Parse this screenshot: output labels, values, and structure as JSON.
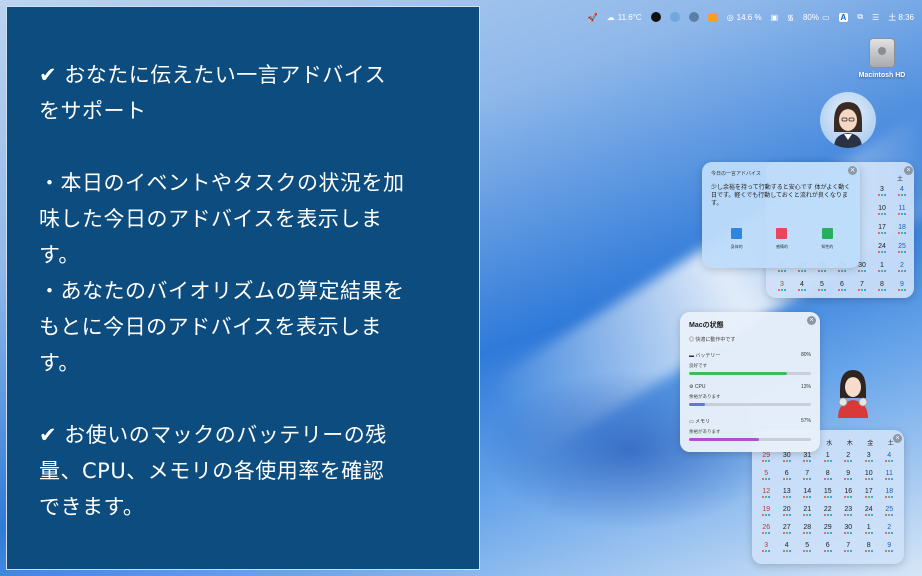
{
  "menubar": {
    "temperature": "11.6°C",
    "cpu_percent": "14.6 %",
    "battery_percent": "80%",
    "input_mode": "A",
    "time": "土 8:36"
  },
  "panel": {
    "line1": "✔ おなたに伝えたい一言アドバイス",
    "line2": "をサポート",
    "line3": "・本日のイベントやタスクの状況を加",
    "line4": "味した今日のアドバイスを表示しま",
    "line5": "す。",
    "line6": "・あなたのバイオリズムの算定結果を",
    "line7": "もとに今日のアドバイスを表示しま",
    "line8": "す。",
    "line9": "✔ お使いのマックのバッテリーの残",
    "line10": "量、CPU、メモリの各使用率を確認",
    "line11": "できます。"
  },
  "drive": {
    "label": "Macintosh HD"
  },
  "advice_widget": {
    "title": "今日の一言アドバイス",
    "message": "少し余裕を持って行動すると安心です 体がよく動く日です。軽くでも行動しておくと流れが良くなります。",
    "bars": [
      {
        "label": "身体的",
        "color": "#2e86de"
      },
      {
        "label": "感情的",
        "color": "#e8465a"
      },
      {
        "label": "知性的",
        "color": "#27ae60"
      }
    ]
  },
  "calendar_top": {
    "visible_header": [
      "土"
    ],
    "rows": [
      [
        "",
        "",
        "",
        "",
        "3",
        "4"
      ],
      [
        "",
        "",
        "",
        "",
        "10",
        "11"
      ],
      [
        "",
        "",
        "",
        "",
        "17",
        "18"
      ],
      [
        "",
        "",
        "",
        "",
        "24",
        "25"
      ],
      [
        "26",
        "27",
        "28",
        "29",
        "30",
        "1",
        "2"
      ],
      [
        "3",
        "4",
        "5",
        "6",
        "7",
        "8",
        "9"
      ]
    ]
  },
  "calendar_bottom": {
    "header": [
      "水",
      "木",
      "金",
      "土"
    ],
    "rows": [
      [
        "29",
        "30",
        "31",
        "1",
        "2",
        "3",
        "4"
      ],
      [
        "5",
        "6",
        "7",
        "8",
        "9",
        "10",
        "11"
      ],
      [
        "12",
        "13",
        "14",
        "15",
        "16",
        "17",
        "18"
      ],
      [
        "19",
        "20",
        "21",
        "22",
        "23",
        "24",
        "25"
      ],
      [
        "26",
        "27",
        "28",
        "29",
        "30",
        "1",
        "2"
      ],
      [
        "3",
        "4",
        "5",
        "6",
        "7",
        "8",
        "9"
      ]
    ]
  },
  "mac_widget": {
    "title": "Macの状態",
    "status": "快適に動作中です",
    "battery": {
      "label": "バッテリー",
      "value": "80%",
      "sub": "良好です",
      "fraction": 0.8,
      "color": "#3dbb5e"
    },
    "cpu": {
      "label": "CPU",
      "value": "13%",
      "sub": "余裕があります",
      "fraction": 0.13,
      "color": "#4f7fd9"
    },
    "memory": {
      "label": "メモリ",
      "value": "57%",
      "sub": "余裕があります",
      "fraction": 0.57,
      "color": "#b04fd0"
    }
  }
}
